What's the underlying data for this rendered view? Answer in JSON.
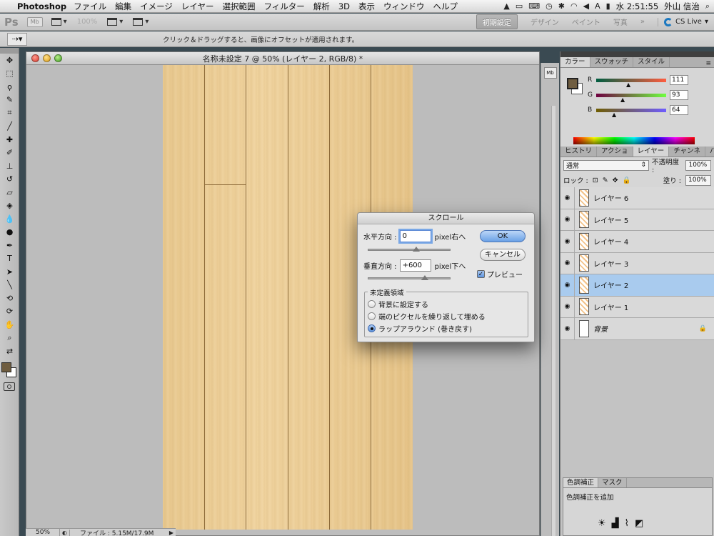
{
  "menubar": {
    "app": "Photoshop",
    "items": [
      "ファイル",
      "編集",
      "イメージ",
      "レイヤー",
      "選択範囲",
      "フィルター",
      "解析",
      "3D",
      "表示",
      "ウィンドウ",
      "ヘルプ"
    ],
    "clock": "水 2:51:55",
    "user": "外山 信治"
  },
  "appbar": {
    "ps": "Ps",
    "mb": "Mb",
    "zoom": "100%",
    "workspaces": [
      "初期設定",
      "デザイン",
      "ペイント",
      "写真"
    ],
    "more": "»",
    "cslive": "CS Live"
  },
  "options": {
    "message": "クリック＆ドラッグすると、画像にオフセットが適用されます。"
  },
  "document": {
    "title": "名称未設定 7 @ 50% (レイヤー 2, RGB/8) *"
  },
  "status": {
    "zoom": "50%",
    "info": "ファイル : 5.15M/17.9M"
  },
  "color_panel": {
    "tabs": [
      "カラー",
      "スウォッチ",
      "スタイル"
    ],
    "r_label": "R",
    "r": "111",
    "g_label": "G",
    "g": "93",
    "b_label": "B",
    "b": "64",
    "fg_color": "#6f5d40"
  },
  "layers_panel": {
    "tabs": [
      "ヒストリ",
      "アクショ",
      "レイヤー",
      "チャンネ",
      "パス"
    ],
    "blend": "通常",
    "opacity_label": "不透明度 :",
    "opacity": "100%",
    "lock_label": "ロック :",
    "fill_label": "塗り :",
    "fill": "100%",
    "layers": [
      {
        "name": "レイヤー 6"
      },
      {
        "name": "レイヤー 5"
      },
      {
        "name": "レイヤー 4"
      },
      {
        "name": "レイヤー 3"
      },
      {
        "name": "レイヤー 2"
      },
      {
        "name": "レイヤー 1"
      },
      {
        "name": "背景"
      }
    ]
  },
  "adjust_panel": {
    "tabs": [
      "色調補正",
      "マスク"
    ],
    "title": "色調補正を追加"
  },
  "dialog": {
    "title": "スクロール",
    "horizontal_label": "水平方向 :",
    "horizontal_value": "0",
    "horizontal_unit": "pixel右へ",
    "vertical_label": "垂直方向 :",
    "vertical_value": "+600",
    "vertical_unit": "pixel下へ",
    "ok": "OK",
    "cancel": "キャンセル",
    "preview": "プレビュー",
    "group_label": "未定義領域",
    "options": [
      "背景に設定する",
      "端のピクセルを繰り返して埋める",
      "ラップアラウンド (巻き戻す)"
    ]
  }
}
